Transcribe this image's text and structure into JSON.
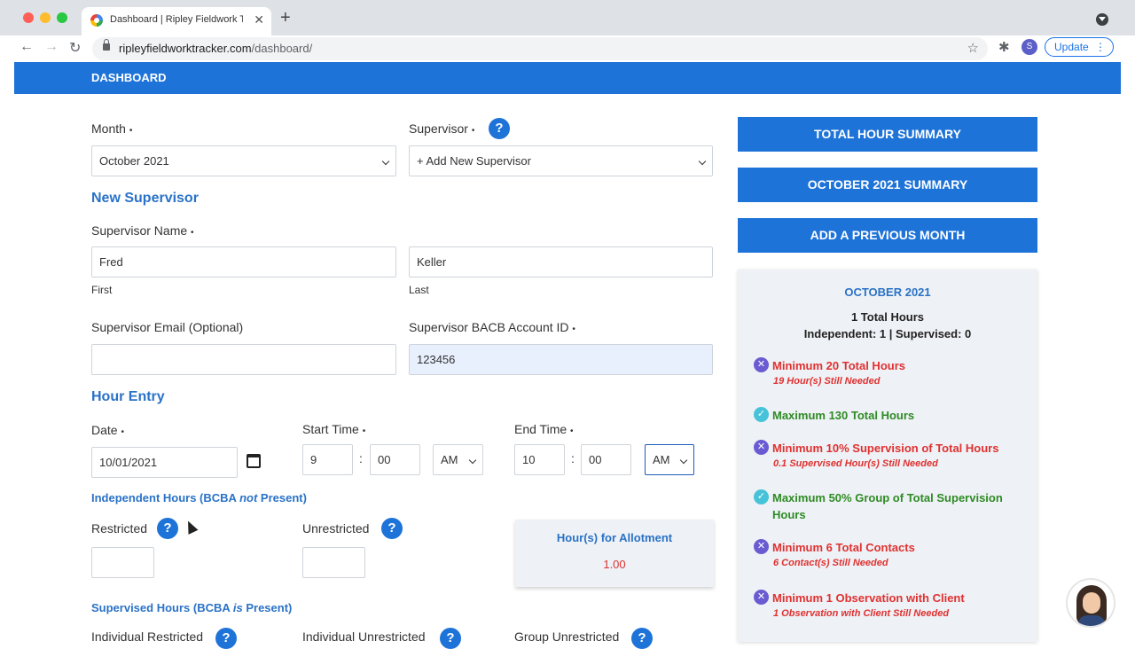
{
  "browser": {
    "tab_title": "Dashboard | Ripley Fieldwork T",
    "url_domain": "ripleyfieldworktracker.com",
    "url_path": "/dashboard/",
    "avatar_letter": "S",
    "update_label": "Update",
    "close_glyph": "✕",
    "newtab_glyph": "+",
    "dots_glyph": "⋮",
    "star_glyph": "☆",
    "ext_glyph": "✱",
    "back_glyph": "←",
    "forward_glyph": "→",
    "reload_glyph": "↻"
  },
  "header": {
    "title": "DASHBOARD"
  },
  "form": {
    "month_label": "Month",
    "month_value": "October 2021",
    "supervisor_label": "Supervisor",
    "supervisor_value": "+ Add New Supervisor",
    "required_mark": "•",
    "help_glyph": "?",
    "new_supervisor_title": "New Supervisor",
    "supervisor_name_label": "Supervisor Name",
    "first_value": "Fred",
    "first_caption": "First",
    "last_value": "Keller",
    "last_caption": "Last",
    "email_label": "Supervisor Email (Optional)",
    "email_value": "",
    "bacb_label": "Supervisor BACB Account ID",
    "bacb_value": "123456",
    "hour_entry_title": "Hour Entry",
    "date_label": "Date",
    "date_value": "10/01/2021",
    "start_label": "Start Time",
    "start_hour": "9",
    "start_min": "00",
    "start_ampm": "AM",
    "end_label": "End Time",
    "end_hour": "10",
    "end_min": "00",
    "end_ampm": "AM",
    "colon": ":",
    "independent_title_a": "Independent Hours (BCBA ",
    "independent_title_em": "not",
    "independent_title_b": " Present)",
    "restricted_label": "Restricted",
    "unrestricted_label": "Unrestricted",
    "allotment_title": "Hour(s) for Allotment",
    "allotment_value": "1.00",
    "supervised_title_a": "Supervised Hours (BCBA ",
    "supervised_title_em": "is",
    "supervised_title_b": " Present)",
    "individual_restricted_label": "Individual Restricted",
    "individual_unrestricted_label": "Individual Unrestricted",
    "group_unrestricted_label": "Group Unrestricted"
  },
  "sidebar": {
    "buttons": [
      "TOTAL HOUR SUMMARY",
      "OCTOBER 2021 SUMMARY",
      "ADD A PREVIOUS MONTH"
    ],
    "summary_title": "OCTOBER 2021",
    "total_hours": "1 Total Hours",
    "split": "Independent: 1 | Supervised: 0",
    "requirements": [
      {
        "status": "fail",
        "icon": "x-circle-icon",
        "text": "Minimum 20 Total Hours",
        "note": "19 Hour(s) Still Needed"
      },
      {
        "status": "pass",
        "icon": "check-circle-icon",
        "text": "Maximum 130 Total Hours",
        "note": ""
      },
      {
        "status": "fail",
        "icon": "x-circle-icon",
        "text": "Minimum 10% Supervision of Total Hours",
        "note": "0.1 Supervised Hour(s) Still Needed"
      },
      {
        "status": "pass",
        "icon": "check-circle-icon",
        "text": "Maximum 50% Group of Total Supervision Hours",
        "note": ""
      },
      {
        "status": "fail",
        "icon": "x-circle-icon",
        "text": "Minimum 6 Total Contacts",
        "note": "6 Contact(s) Still Needed"
      },
      {
        "status": "fail",
        "icon": "x-circle-icon",
        "text": "Minimum 1 Observation with Client",
        "note": "1 Observation with Client Still Needed"
      }
    ],
    "fail_glyph": "✕",
    "pass_glyph": "✓"
  },
  "colors": {
    "brand": "#1e73d8",
    "fail": "#e03131",
    "pass": "#2e8b24"
  }
}
